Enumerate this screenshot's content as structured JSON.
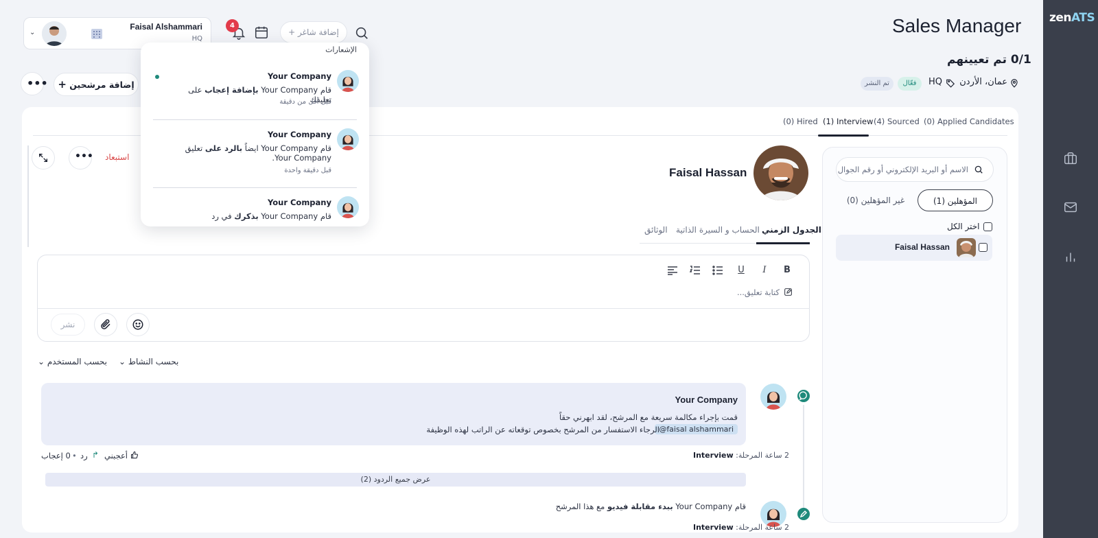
{
  "brand": {
    "logo_main": "zen",
    "logo_accent": "ATS"
  },
  "header": {
    "user_name": "Faisal Alshammari",
    "user_org": "HQ",
    "notif_count": "4",
    "add_job": "+ إضافة شاغر"
  },
  "notifications": {
    "heading": "الإشعارات",
    "items": [
      {
        "title": "Your Company",
        "body_pre": "قام Your Company ",
        "body_bold": "بإضافة إعجاب",
        "body_post": " على تعليقك",
        "time": "قبل أقل من دقيقة",
        "unread": true
      },
      {
        "title": "Your Company",
        "body_pre": "قام Your Company ايضاً ",
        "body_bold": "بالرد على",
        "body_post": " تعليق Your Company.",
        "time": "قبل دقيقة واحدة",
        "unread": false
      },
      {
        "title": "Your Company",
        "body_pre": "قام Your Company ",
        "body_bold": "بذكرك",
        "body_post": " في رد",
        "time": "",
        "unread": false
      }
    ]
  },
  "job": {
    "title": "Sales Manager",
    "assigned": "0/1 تم تعيينهم",
    "location": "عمان، الأردن",
    "org": "HQ",
    "status_active": "فعّال",
    "status_published": "تم النشر",
    "add_candidates": "إضافة مرشحين"
  },
  "tabs": [
    {
      "label": "(0) Applied Candidates"
    },
    {
      "label": "(4) Sourced"
    },
    {
      "label": "(1) Interview"
    },
    {
      "label": "(0) Hired"
    }
  ],
  "side": {
    "search_placeholder": "الاسم أو البريد الإلكتروني أو رقم الجوال",
    "qualified": "المؤهلين (1)",
    "unqualified": "غير المؤهلين (0)",
    "select_all": "اختر الكل",
    "candidate": "Faisal Hassan"
  },
  "profile": {
    "name": "Faisal Hassan",
    "exclude": "استبعاد",
    "subtabs": [
      "الجدول الزمني",
      "الحساب و السيرة الذاتية",
      "الوثائق"
    ]
  },
  "editor": {
    "placeholder": "كتابة تعليق...",
    "publish": "نشر",
    "toolbar": [
      "B",
      "I",
      "U"
    ]
  },
  "filters": {
    "by_activity": "بحسب النشاط",
    "by_user": "بحسب المستخدم"
  },
  "comment": {
    "author": "Your Company",
    "line1": "قمت بإجراء مكالمة سريعة مع المرشح، لقد ابهرني حقاً",
    "mention": "@faisal alshammari",
    "line2": "الرجاء الاستفسار من المرشح بخصوص توقعاته عن الراتب لهذه الوظيفة",
    "stage_label": "2 ساعة المرحلة:",
    "stage_value": "Interview",
    "like": "أعجبني",
    "reply": "رد",
    "likes_count": "0 إعجاب",
    "show_replies": "عرض جميع الردود (2)"
  },
  "activity": {
    "pre": "قام Your Company ",
    "bold": "ببدء مقابلة فيديو",
    "post": " مع هذا المرشح",
    "stage_label": "2 ساعة المرحلة:",
    "stage_value": "Interview"
  },
  "colors": {
    "rail": "#3a3f4b",
    "accent_teal": "#1f8a7b",
    "danger": "#d94848",
    "badge_red": "#e23b4a"
  }
}
